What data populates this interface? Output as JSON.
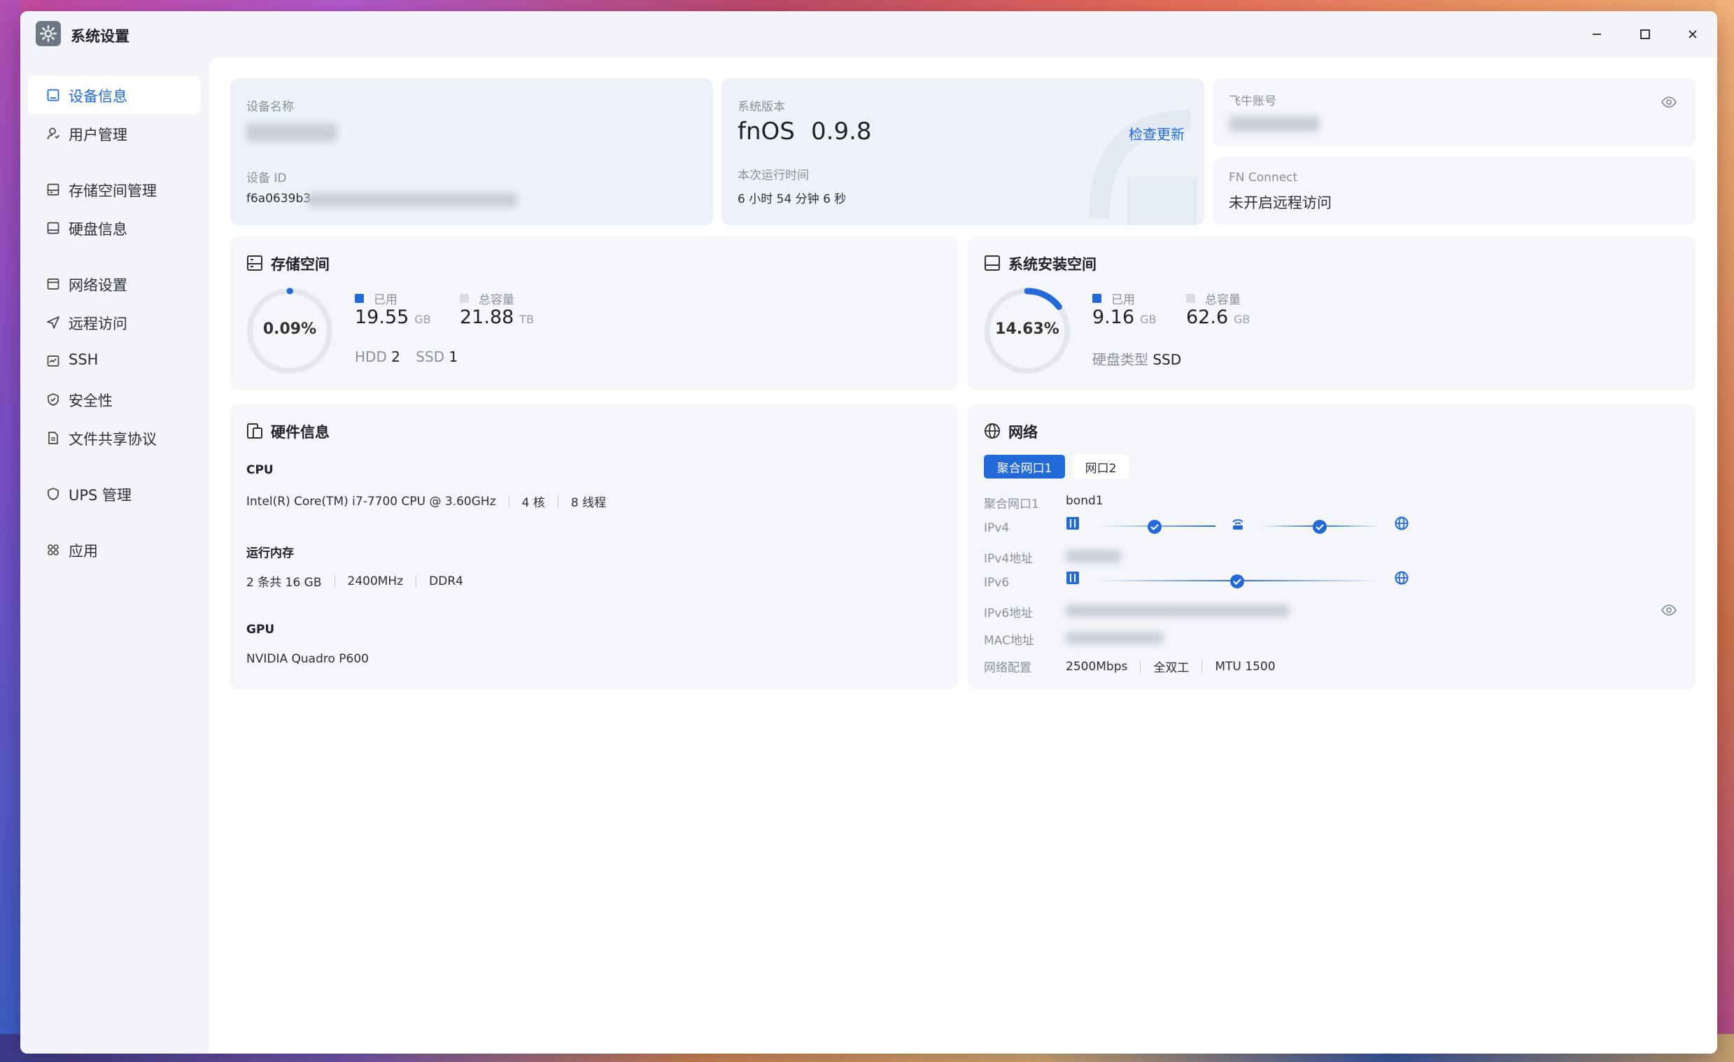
{
  "window": {
    "title": "系统设置"
  },
  "sidebar": {
    "items": [
      {
        "label": "设备信息",
        "icon": "device-info-icon",
        "active": true
      },
      {
        "label": "用户管理",
        "icon": "user-icon"
      },
      {
        "label": "存储空间管理",
        "icon": "storage-icon"
      },
      {
        "label": "硬盘信息",
        "icon": "disk-icon"
      },
      {
        "label": "网络设置",
        "icon": "network-icon"
      },
      {
        "label": "远程访问",
        "icon": "send-icon"
      },
      {
        "label": "SSH",
        "icon": "terminal-icon"
      },
      {
        "label": "安全性",
        "icon": "shield-icon"
      },
      {
        "label": "文件共享协议",
        "icon": "file-icon"
      },
      {
        "label": "UPS 管理",
        "icon": "ups-shield-icon"
      },
      {
        "label": "应用",
        "icon": "apps-icon"
      }
    ]
  },
  "device": {
    "name_label": "设备名称",
    "id_label": "设备 ID",
    "id_value": "f6a0639b3"
  },
  "system": {
    "version_label": "系统版本",
    "os_name": "fnOS",
    "version": "0.9.8",
    "check_update": "检查更新",
    "uptime_label": "本次运行时间",
    "uptime": "6 小时 54 分钟 6 秒"
  },
  "account": {
    "label": "飞牛账号",
    "fn_connect_label": "FN Connect",
    "fn_connect_value": "未开启远程访问"
  },
  "storage": {
    "title": "存储空间",
    "percent": "0.09%",
    "percent_value": 0.09,
    "used_label": "已用",
    "used_value": "19.55",
    "used_unit": "GB",
    "total_label": "总容量",
    "total_value": "21.88",
    "total_unit": "TB",
    "hdd_label": "HDD",
    "hdd_count": "2",
    "ssd_label": "SSD",
    "ssd_count": "1"
  },
  "sysinstall": {
    "title": "系统安装空间",
    "percent": "14.63%",
    "percent_value": 14.63,
    "used_label": "已用",
    "used_value": "9.16",
    "used_unit": "GB",
    "total_label": "总容量",
    "total_value": "62.6",
    "total_unit": "GB",
    "disk_type_label": "硬盘类型",
    "disk_type": "SSD"
  },
  "hardware": {
    "title": "硬件信息",
    "cpu_label": "CPU",
    "cpu_model": "Intel(R) Core(TM) i7-7700 CPU @ 3.60GHz",
    "cpu_cores": "4 核",
    "cpu_threads": "8 线程",
    "ram_label": "运行内存",
    "ram_size": "2 条共 16 GB",
    "ram_freq": "2400MHz",
    "ram_type": "DDR4",
    "gpu_label": "GPU",
    "gpu_model": "NVIDIA Quadro P600"
  },
  "network": {
    "title": "网络",
    "tabs": [
      "聚合网口1",
      "网口2"
    ],
    "iface_label": "聚合网口1",
    "iface_value": "bond1",
    "ipv4_label": "IPv4",
    "ipv4_addr_label": "IPv4地址",
    "ipv6_label": "IPv6",
    "ipv6_addr_label": "IPv6地址",
    "mac_label": "MAC地址",
    "config_label": "网络配置",
    "speed": "2500Mbps",
    "duplex": "全双工",
    "mtu": "MTU 1500"
  },
  "colors": {
    "accent": "#2369d8",
    "ring_track": "#e3e6eb",
    "total_legend": "#d9dce1"
  }
}
